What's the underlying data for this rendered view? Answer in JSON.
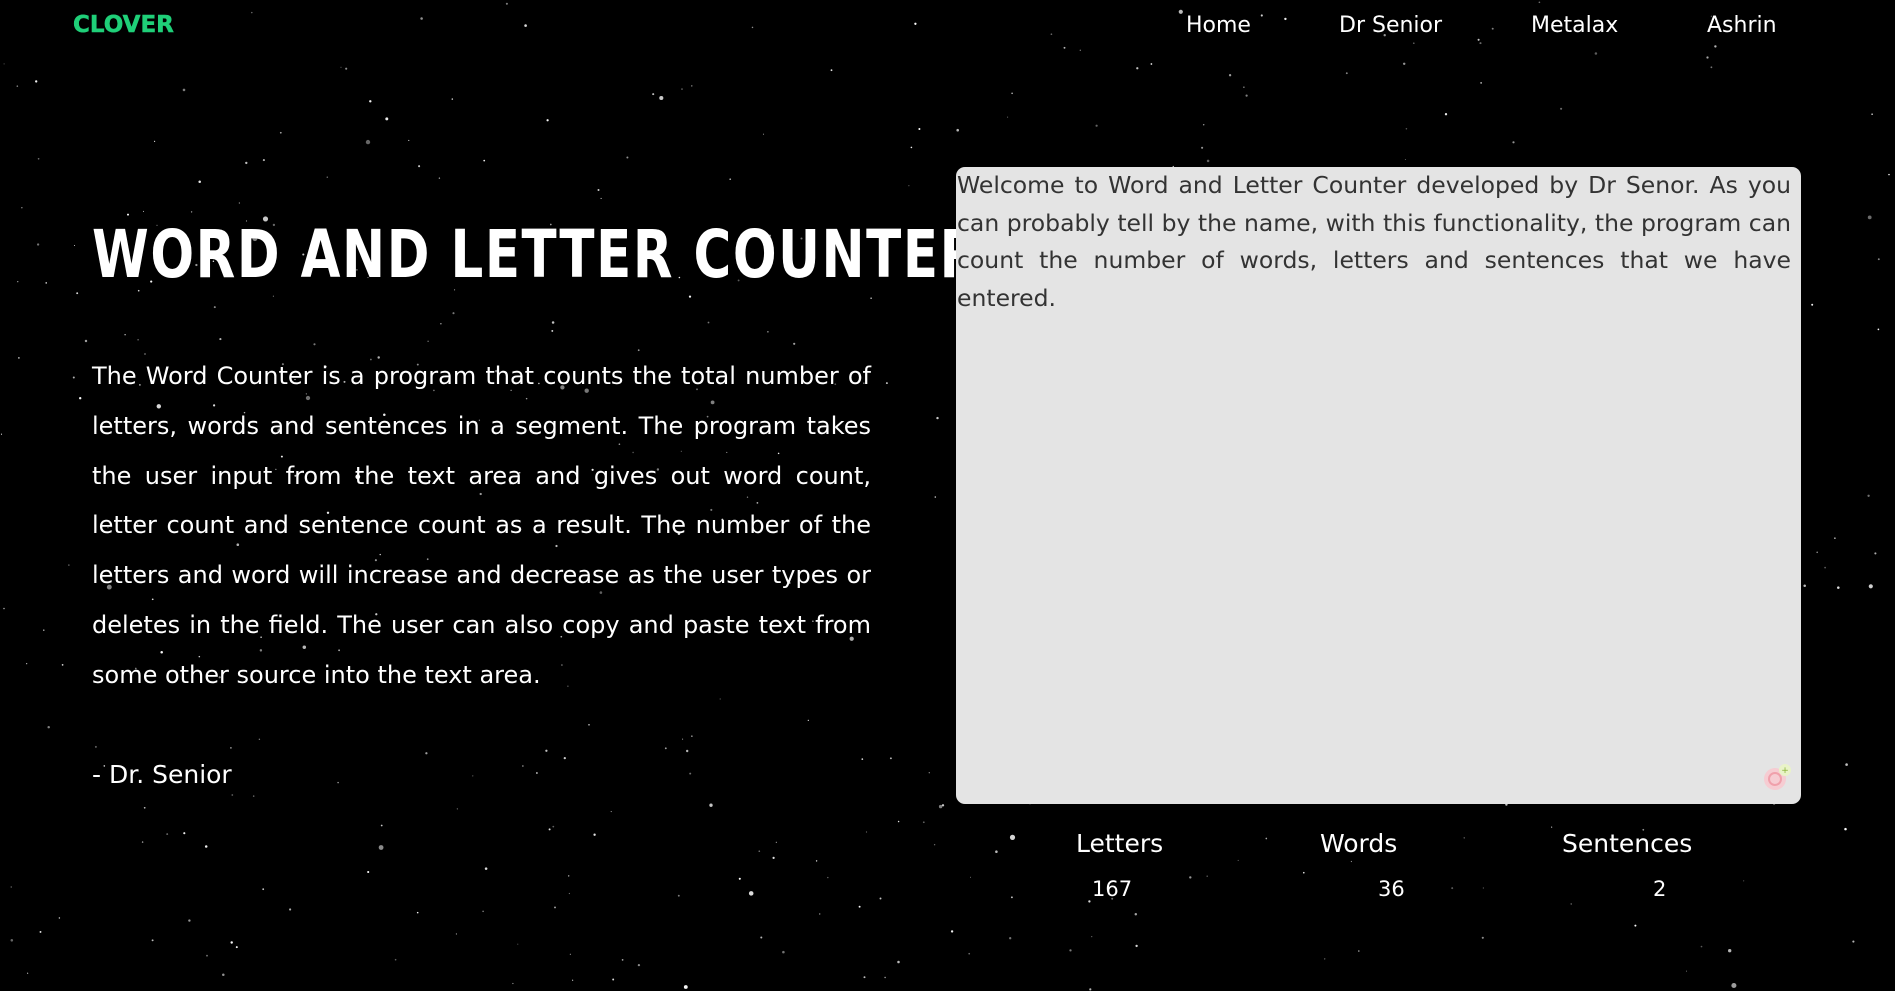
{
  "header": {
    "logo": "CLOVER",
    "nav": [
      {
        "label": "Home"
      },
      {
        "label": "Dr Senior"
      },
      {
        "label": "Metalax"
      },
      {
        "label": "Ashrin"
      }
    ]
  },
  "main": {
    "title": "WORD AND LETTER COUNTER",
    "description": "The Word Counter is a program that counts the total number of letters, words and sentences in a segment. The program takes the user input from the text area and gives out word count, letter count and sentence count as a result. The number of the letters and word will increase and decrease as the user types or deletes in the field. The user can also copy and paste text from some other source into the text area.",
    "signature": "- Dr. Senior"
  },
  "editor": {
    "value": "Welcome to Word and Letter Counter developed by Dr Senor. As you can probably tell by the name, with this functionality, the program can count the number of words, letters and sentences that we have entered."
  },
  "stats": {
    "letters_label": "Letters",
    "letters_value": "167",
    "words_label": "Words",
    "words_value": "36",
    "sentences_label": "Sentences",
    "sentences_value": "2"
  },
  "colors": {
    "background": "#000000",
    "logo": "#1fcf78",
    "editor_bg": "#e4e4e4",
    "text": "#ffffff"
  }
}
